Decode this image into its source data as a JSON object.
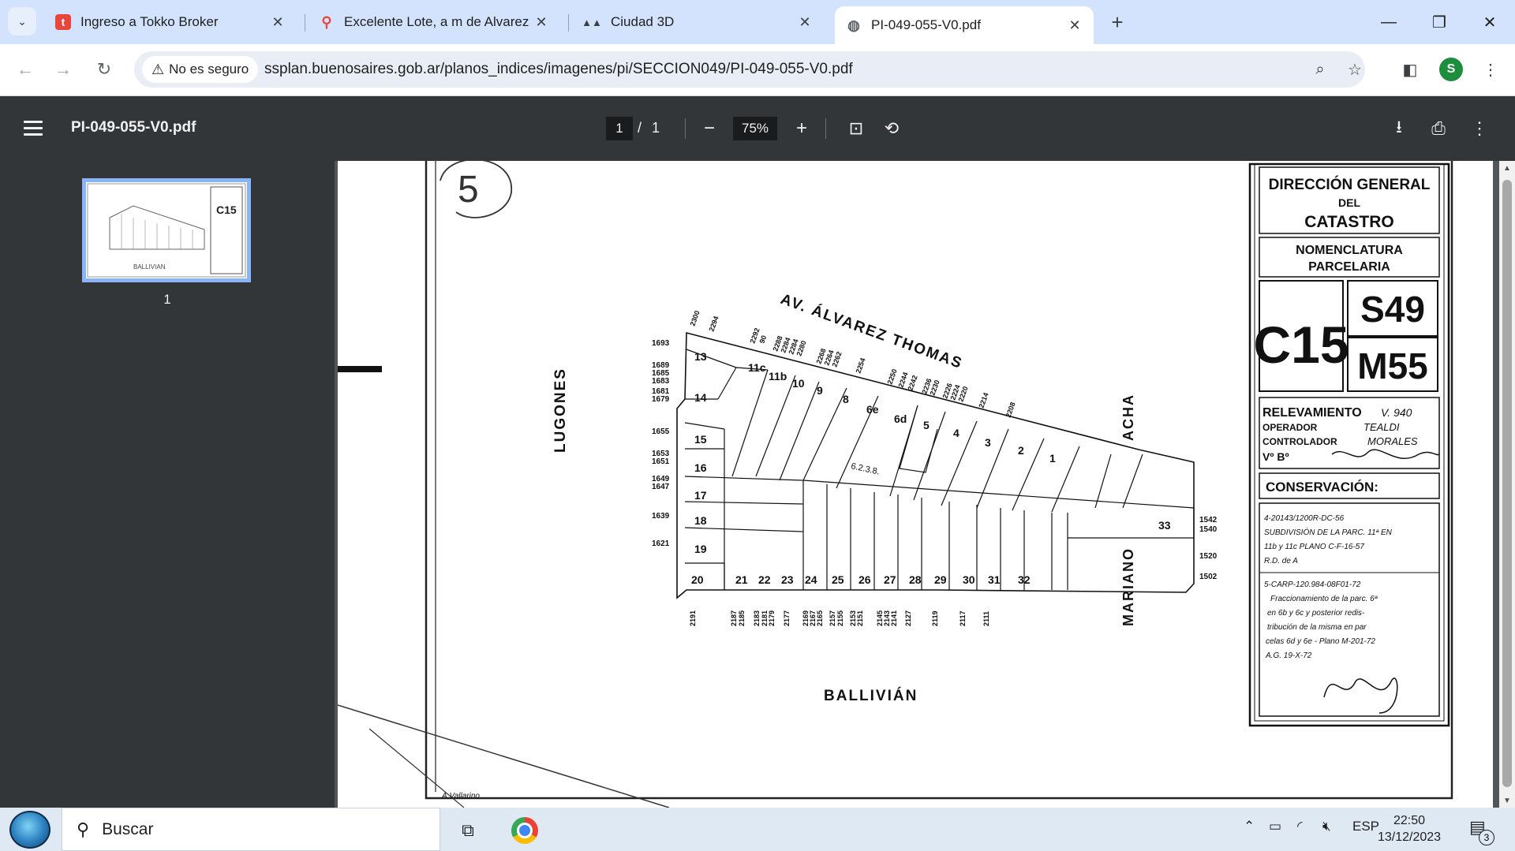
{
  "browser": {
    "tabs": [
      {
        "title": "Ingreso a Tokko Broker",
        "favicon": "tokko-icon",
        "favicon_color": "#e8453c"
      },
      {
        "title": "Excelente Lote, a m de Alvarez T",
        "favicon": "map-pin-icon",
        "favicon_color": "#e8453c"
      },
      {
        "title": "Ciudad 3D",
        "favicon": "ba-logo-icon",
        "favicon_color": "#3c4043"
      },
      {
        "title": "PI-049-055-V0.pdf",
        "favicon": "globe-icon",
        "favicon_color": "#5f6368",
        "active": true
      }
    ],
    "security_label": "No es seguro",
    "url": "ssplan.buenosaires.gob.ar/planos_indices/imagenes/pi/SECCION049/PI-049-055-V0.pdf",
    "profile_initial": "S"
  },
  "pdf_viewer": {
    "filename": "PI-049-055-V0.pdf",
    "current_page": "1",
    "page_separator": "/",
    "total_pages": "1",
    "zoom": "75%",
    "thumbnail_label": "1"
  },
  "document": {
    "circled_label": "5",
    "streets": {
      "north": "AV. ÁLVAREZ THOMAS",
      "west": "LUGONES",
      "south": "BALLIVIÁN",
      "east_1": "MARIANO",
      "east_2": "ACHA"
    },
    "top_addresses": [
      "2300",
      "2294",
      "2292",
      "90",
      "2288",
      "2284",
      "2284",
      "2280",
      "2268",
      "2264",
      "2262",
      "2254",
      "2250",
      "2244",
      "2242",
      "2236",
      "2230",
      "2226",
      "2224",
      "2220",
      "2214",
      "2208"
    ],
    "left_addresses": [
      "1693",
      "1689",
      "1685",
      "1683",
      "1681",
      "1679",
      "1655",
      "1653",
      "1651",
      "1649",
      "1647",
      "1639",
      "1621"
    ],
    "right_addresses": [
      "1542",
      "1540",
      "1520",
      "1502"
    ],
    "bottom_addresses": [
      "2191",
      "2187",
      "2185",
      "2183",
      "2181",
      "2179",
      "2177",
      "2169",
      "2167",
      "2165",
      "2157",
      "2155",
      "2153",
      "2151",
      "2145",
      "2143",
      "2141",
      "2127",
      "2119",
      "2117",
      "2111"
    ],
    "parcels": [
      "1",
      "2",
      "3",
      "4",
      "5",
      "6d",
      "6e",
      "8",
      "9",
      "10",
      "11b",
      "11c",
      "13",
      "14",
      "15",
      "16",
      "17",
      "18",
      "19",
      "20",
      "21",
      "22",
      "23",
      "24",
      "25",
      "26",
      "27",
      "28",
      "29",
      "30",
      "31",
      "32",
      "33"
    ],
    "inner_note": "6.2.3.8.",
    "title_block": {
      "header_line1": "DIRECCIÓN GENERAL",
      "header_line2": "DEL",
      "header_line3": "CATASTRO",
      "nomenclature_line1": "NOMENCLATURA",
      "nomenclature_line2": "PARCELARIA",
      "circ": "C15",
      "section": "S49",
      "block": "M55",
      "survey_label": "RELEVAMIENTO",
      "survey_value": "V. 940",
      "operator_label": "OPERADOR",
      "operator_value": "TEALDI",
      "controller_label": "CONTROLADOR",
      "controller_value": "MORALES",
      "approval_label": "Vº Bº",
      "conservation_label": "CONSERVACIÓN:",
      "notes": [
        "4-20143/1200R-DC-56",
        "SUBDIVISIÓN DE LA PARC. 11ª EN",
        "11b y 11c PLANO C-F-16-57",
        "R.D. de A",
        "5-CARP-120.984-08F01-72",
        "Fraccionamiento de la parc. 6ª",
        "en 6b y 6c y posterior redis-",
        "tribución de la misma en par",
        "celas 6d y 6e - Plano M-201-72",
        "A.G. 19-X-72"
      ],
      "corner_signature": "A.Vallarino"
    }
  },
  "taskbar": {
    "search_placeholder": "Buscar",
    "language": "ESP",
    "time": "22:50",
    "date": "13/12/2023",
    "notification_count": "3"
  }
}
